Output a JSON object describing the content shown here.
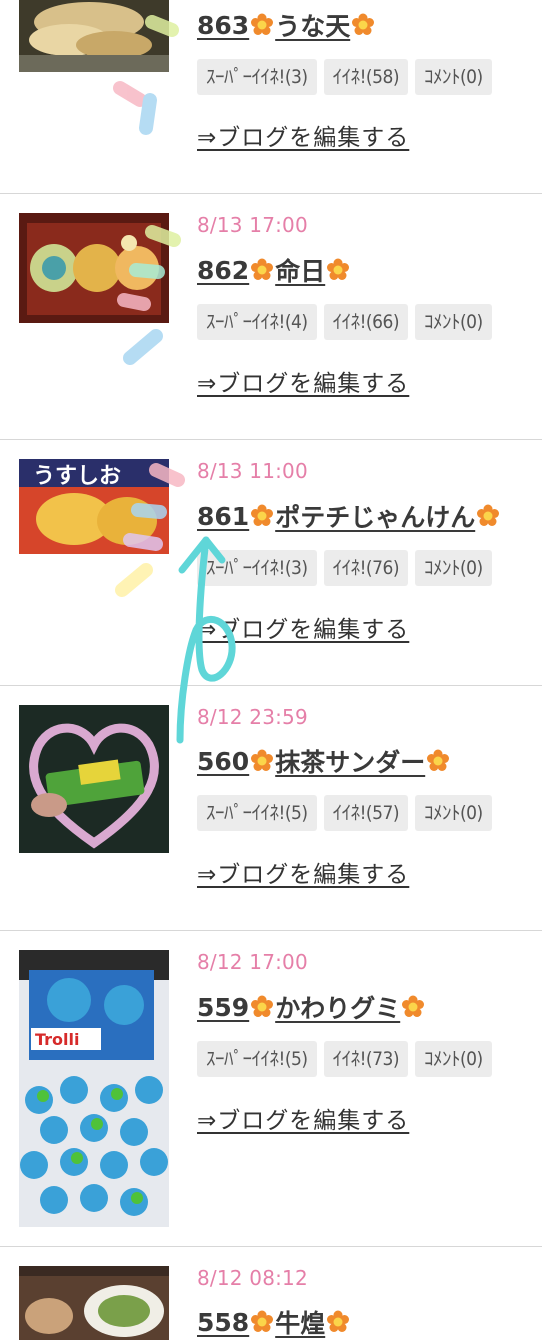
{
  "feed": {
    "posts": [
      {
        "date": "",
        "title_text": "863",
        "title_rest": "うな天",
        "super_like": "ｽｰﾊﾟｰｲｲﾈ!(3)",
        "like": "ｲｲﾈ!(58)",
        "comment": "ｺﾒﾝﾄ(0)",
        "edit_label": "⇒ブログを編集する",
        "thumb_icon": "fried-food-photo"
      },
      {
        "date": "8/13 17:00",
        "title_text": "862",
        "title_rest": "命日",
        "super_like": "ｽｰﾊﾟｰｲｲﾈ!(4)",
        "like": "ｲｲﾈ!(66)",
        "comment": "ｺﾒﾝﾄ(0)",
        "edit_label": "⇒ブログを編集する",
        "thumb_icon": "sweets-box-photo"
      },
      {
        "date": "8/13 11:00",
        "title_text": "861",
        "title_rest": "ポテチじゃんけん",
        "super_like": "ｽｰﾊﾟｰｲｲﾈ!(3)",
        "like": "ｲｲﾈ!(76)",
        "comment": "ｺﾒﾝﾄ(0)",
        "edit_label": "⇒ブログを編集する",
        "thumb_icon": "chips-bag-photo",
        "thumb_text": "うすしお"
      },
      {
        "date": "8/12 23:59",
        "title_text": "560",
        "title_rest": "抹茶サンダー",
        "super_like": "ｽｰﾊﾟｰｲｲﾈ!(5)",
        "like": "ｲｲﾈ!(57)",
        "comment": "ｺﾒﾝﾄ(0)",
        "edit_label": "⇒ブログを編集する",
        "thumb_icon": "matcha-bar-photo"
      },
      {
        "date": "8/12 17:00",
        "title_text": "559",
        "title_rest": "かわりグミ",
        "super_like": "ｽｰﾊﾟｰｲｲﾈ!(5)",
        "like": "ｲｲﾈ!(73)",
        "comment": "ｺﾒﾝﾄ(0)",
        "edit_label": "⇒ブログを編集する",
        "thumb_icon": "earth-gummy-photo",
        "thumb_text": "Trolli"
      },
      {
        "date": "8/12 08:12",
        "title_text": "558",
        "title_rest": "牛煌",
        "thumb_icon": "dinner-plate-photo"
      }
    ]
  },
  "colors": {
    "date": "#e57fa8",
    "badge_bg": "#ececec",
    "divider": "#d7d7d7",
    "flower": "#f08a2c",
    "arrow": "#5fd6d8"
  }
}
